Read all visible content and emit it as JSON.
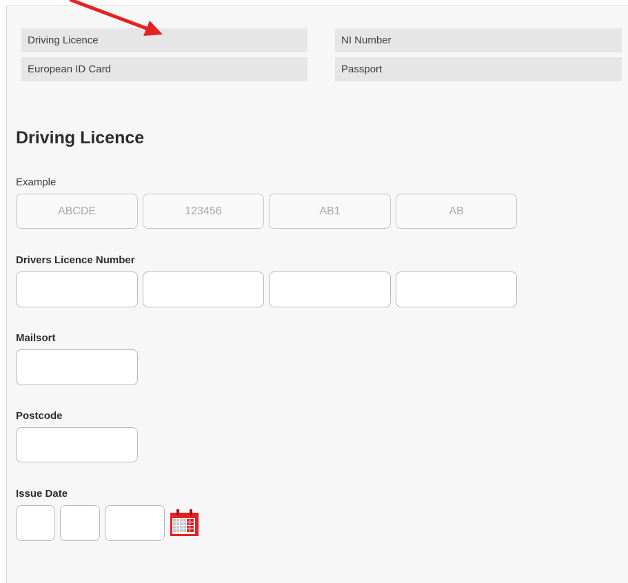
{
  "document_types": [
    {
      "label": "Driving Licence"
    },
    {
      "label": "NI Number"
    },
    {
      "label": "European ID Card"
    },
    {
      "label": "Passport"
    }
  ],
  "section_title": "Driving Licence",
  "example": {
    "label": "Example",
    "values": [
      "ABCDE",
      "123456",
      "AB1",
      "AB"
    ]
  },
  "drivers_licence_number": {
    "label": "Drivers Licence Number",
    "values": [
      "",
      "",
      "",
      ""
    ]
  },
  "mailsort": {
    "label": "Mailsort",
    "value": ""
  },
  "postcode": {
    "label": "Postcode",
    "value": ""
  },
  "issue_date": {
    "label": "Issue Date",
    "day": "",
    "month": "",
    "year": ""
  },
  "icons": {
    "calendar": "calendar-icon",
    "annotation": "red-arrow-annotation"
  },
  "colors": {
    "accent_red": "#e52121",
    "option_bg": "#e6e6e6",
    "panel_bg": "#f7f7f7"
  }
}
